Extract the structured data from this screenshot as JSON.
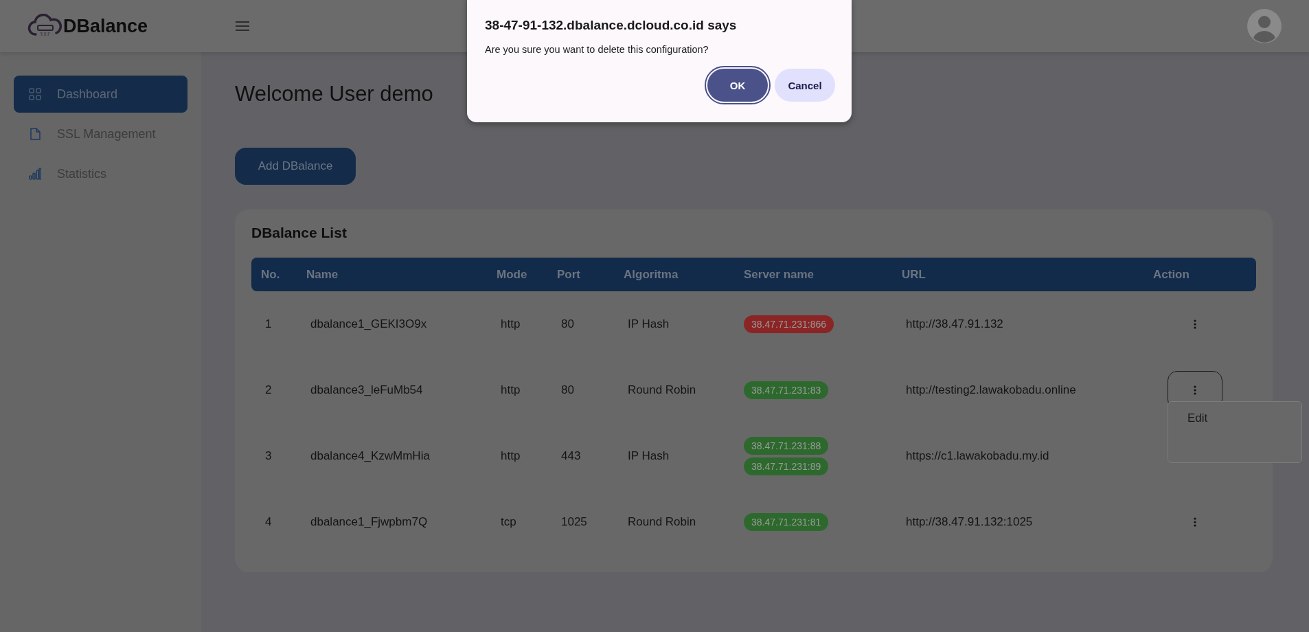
{
  "header": {
    "brand": "DBalance"
  },
  "sidebar": {
    "items": [
      {
        "label": "Dashboard",
        "selected": true
      },
      {
        "label": "SSL Management",
        "selected": false
      },
      {
        "label": "Statistics",
        "selected": false
      }
    ]
  },
  "main": {
    "welcome": "Welcome User demo",
    "add_button": "Add DBalance"
  },
  "list": {
    "title": "DBalance List",
    "columns": [
      "No.",
      "Name",
      "Mode",
      "Port",
      "Algoritma",
      "Server name",
      "URL",
      "Action"
    ],
    "rows": [
      {
        "no": "1",
        "name": "dbalance1_GEKI3O9x",
        "mode": "http",
        "port": "80",
        "algorithm": "IP Hash",
        "servers": [
          {
            "address": "38.47.71.231:866",
            "color": "#8b2525"
          }
        ],
        "url": "http://38.47.91.132",
        "menu_open": false
      },
      {
        "no": "2",
        "name": "dbalance3_leFuMb54",
        "mode": "http",
        "port": "80",
        "algorithm": "Round Robin",
        "servers": [
          {
            "address": "38.47.71.231:83",
            "color": "#2d692d"
          }
        ],
        "url": "http://testing2.lawakobadu.online",
        "menu_open": true,
        "menu_items": [
          "Edit"
        ]
      },
      {
        "no": "3",
        "name": "dbalance4_KzwMmHia",
        "mode": "http",
        "port": "443",
        "algorithm": "IP Hash",
        "servers": [
          {
            "address": "38.47.71.231:88",
            "color": "#2d692d"
          },
          {
            "address": "38.47.71.231:89",
            "color": "#2d692d"
          }
        ],
        "url": "https://c1.lawakobadu.my.id",
        "menu_open": false
      },
      {
        "no": "4",
        "name": "dbalance1_Fjwpbm7Q",
        "mode": "tcp",
        "port": "1025",
        "algorithm": "Round Robin",
        "servers": [
          {
            "address": "38.47.71.231:81",
            "color": "#2d692d"
          }
        ],
        "url": "http://38.47.91.132:1025",
        "menu_open": false
      }
    ]
  },
  "dialog": {
    "title": "38-47-91-132.dbalance.dcloud.co.id says",
    "message": "Are you sure you want to delete this configuration?",
    "buttons": [
      {
        "label": "OK",
        "focused": true
      },
      {
        "label": "Cancel",
        "focused": false
      }
    ]
  }
}
